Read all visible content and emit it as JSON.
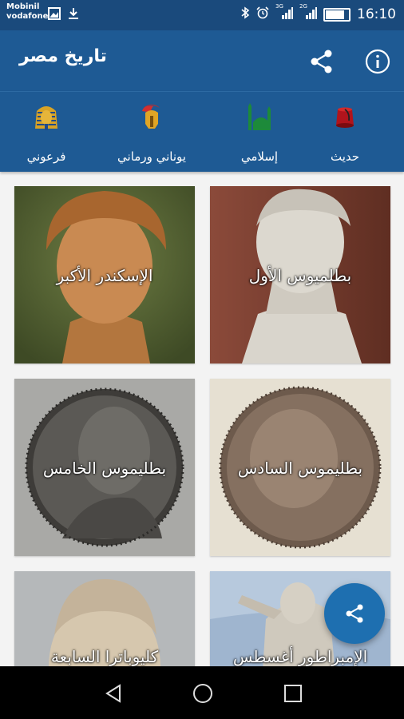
{
  "status_bar": {
    "carrier_1": "Mobinil",
    "carrier_2": "vodafone",
    "signal_1_label": "3G",
    "signal_2_label": "2G",
    "time": "16:10"
  },
  "app": {
    "title": "تاريخ مصر"
  },
  "tabs": [
    {
      "label": "حديث",
      "icon": "fez-icon"
    },
    {
      "label": "إسلامي",
      "icon": "mosque-icon"
    },
    {
      "label": "يوناني ورماني",
      "icon": "roman-helmet-icon"
    },
    {
      "label": "فرعوني",
      "icon": "pharaoh-mask-icon"
    }
  ],
  "cards": [
    {
      "caption": "بطلميوس  الأول"
    },
    {
      "caption": "الإسكندر الأكبر"
    },
    {
      "caption": "بطليموس السادس"
    },
    {
      "caption": "بطليموس الخامس"
    },
    {
      "caption": "الإمبراطور أغسطس"
    },
    {
      "caption": "كليوباترا السابعة"
    }
  ],
  "colors": {
    "status_bar": "#1a4a7c",
    "app_bar": "#1e5a94",
    "fab": "#1e6fb0"
  }
}
